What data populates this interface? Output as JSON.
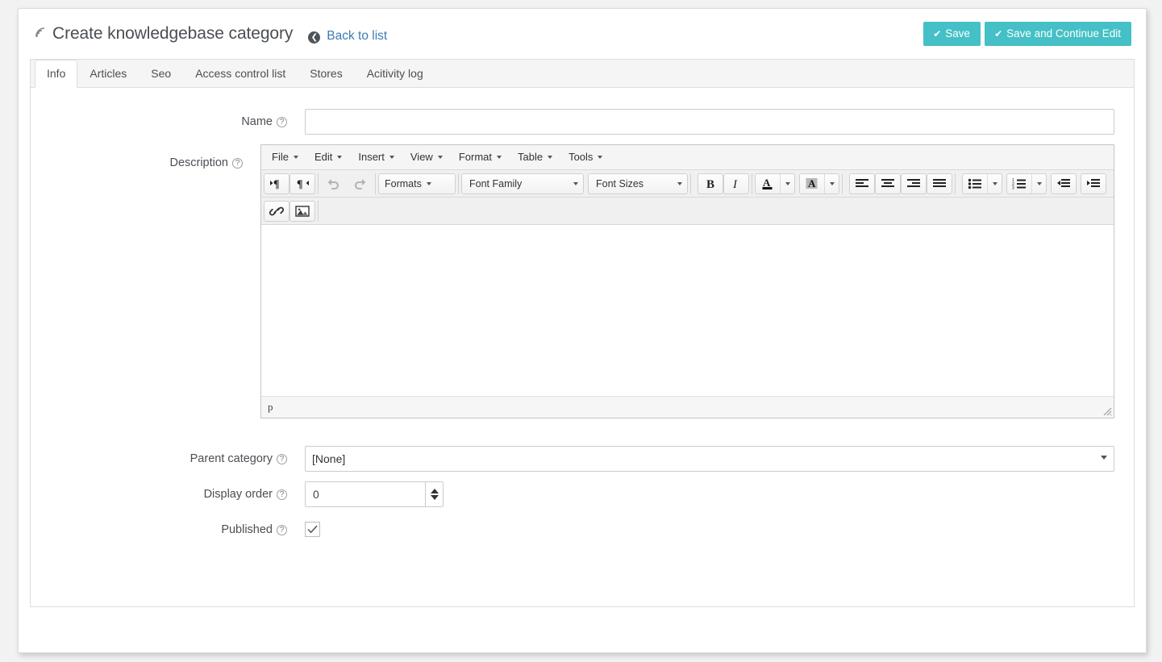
{
  "header": {
    "icon": "layers-icon",
    "title": "Create knowledgebase category",
    "back_icon": "arrow-left-circle-icon",
    "back_label": "Back to list",
    "save_label": "Save",
    "save_icon": "check-icon",
    "save_continue_label": "Save and Continue Edit",
    "save_continue_icon": "check-circle-icon",
    "accent_color": "#44c0c6",
    "link_color": "#3a7cb5"
  },
  "tabs": [
    {
      "label": "Info",
      "active": true
    },
    {
      "label": "Articles",
      "active": false
    },
    {
      "label": "Seo",
      "active": false
    },
    {
      "label": "Access control list",
      "active": false
    },
    {
      "label": "Stores",
      "active": false
    },
    {
      "label": "Acitivity log",
      "active": false
    }
  ],
  "form": {
    "help_glyph": "?",
    "name": {
      "label": "Name",
      "value": "",
      "placeholder": ""
    },
    "description": {
      "label": "Description"
    },
    "parent_category": {
      "label": "Parent category",
      "value": "[None]",
      "options": [
        "[None]"
      ]
    },
    "display_order": {
      "label": "Display order",
      "value": "0"
    },
    "published": {
      "label": "Published",
      "checked": true
    }
  },
  "editor": {
    "menubar": [
      {
        "label": "File"
      },
      {
        "label": "Edit"
      },
      {
        "label": "Insert"
      },
      {
        "label": "View"
      },
      {
        "label": "Format"
      },
      {
        "label": "Table"
      },
      {
        "label": "Tools"
      }
    ],
    "toolbar_row1": [
      {
        "name": "ltr-icon",
        "kind": "icon"
      },
      {
        "name": "rtl-icon",
        "kind": "icon"
      },
      {
        "name": "undo-icon",
        "kind": "icon"
      },
      {
        "name": "redo-icon",
        "kind": "icon"
      },
      {
        "name": "formats-dropdown",
        "kind": "split",
        "label": "Formats"
      },
      {
        "name": "font-family-dropdown",
        "kind": "combo",
        "label": "Font Family"
      },
      {
        "name": "font-sizes-dropdown",
        "kind": "combo",
        "label": "Font Sizes"
      },
      {
        "name": "bold-icon",
        "kind": "icon"
      },
      {
        "name": "italic-icon",
        "kind": "icon"
      },
      {
        "name": "text-color-picker",
        "kind": "color"
      },
      {
        "name": "background-color-picker",
        "kind": "color"
      },
      {
        "name": "align-left-icon",
        "kind": "icon"
      },
      {
        "name": "align-center-icon",
        "kind": "icon"
      },
      {
        "name": "align-right-icon",
        "kind": "icon"
      },
      {
        "name": "align-justify-icon",
        "kind": "icon"
      },
      {
        "name": "bullet-list-dropdown",
        "kind": "list"
      },
      {
        "name": "numbered-list-dropdown",
        "kind": "list"
      },
      {
        "name": "outdent-icon",
        "kind": "icon"
      },
      {
        "name": "indent-icon",
        "kind": "icon"
      }
    ],
    "toolbar_row2": [
      {
        "name": "link-icon",
        "kind": "icon"
      },
      {
        "name": "image-icon",
        "kind": "icon"
      }
    ],
    "labels": {
      "formats": "Formats",
      "font_family": "Font Family",
      "font_sizes": "Font Sizes"
    },
    "content": "",
    "statusbar_path": "p"
  }
}
